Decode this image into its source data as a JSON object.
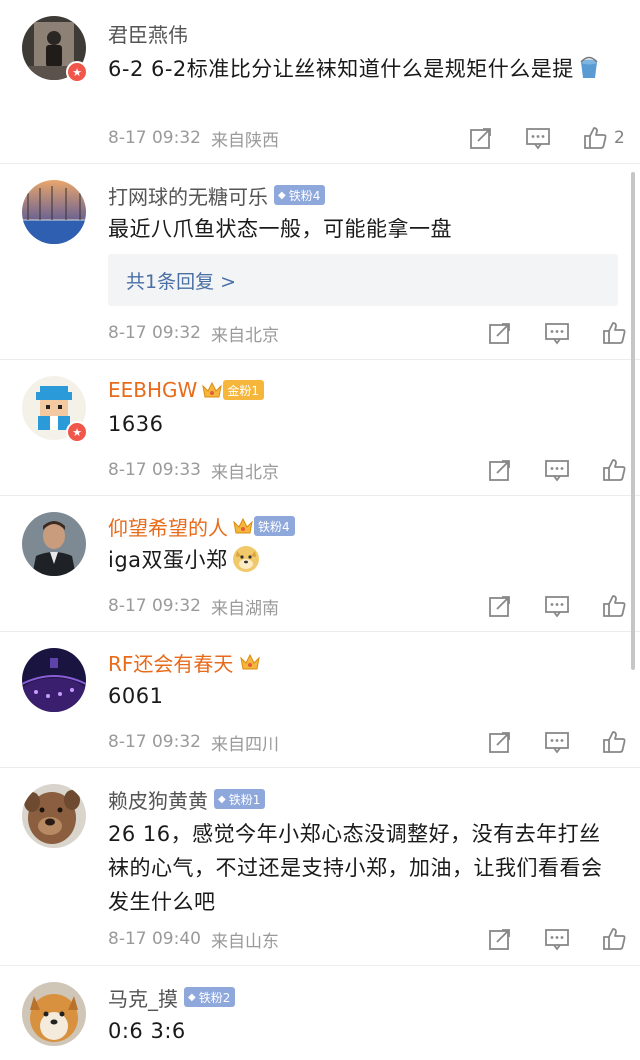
{
  "comments": [
    {
      "username": "君臣燕伟",
      "text": "6-2 6-2标准比分让丝袜知道什么是规矩什么是提",
      "emoji": "bucket-emoji",
      "time": "8-17 09:32",
      "location": "来自陕西",
      "likes": "2",
      "verified": true
    },
    {
      "username": "打网球的无糖可乐",
      "badge": "铁粉4",
      "text": "最近八爪鱼状态一般，可能能拿一盘",
      "reply": "共1条回复 >",
      "time": "8-17 09:32",
      "location": "来自北京"
    },
    {
      "username": "EEBHGW",
      "badge": "金粉1",
      "text": "1636",
      "time": "8-17 09:33",
      "location": "来自北京",
      "verified": true
    },
    {
      "username": "仰望希望的人",
      "badge": "铁粉4",
      "text": "iga双蛋小郑",
      "emoji": "doge-emoji",
      "time": "8-17 09:32",
      "location": "来自湖南"
    },
    {
      "username": "RF还会有春天",
      "text": "6061",
      "time": "8-17 09:32",
      "location": "来自四川"
    },
    {
      "username": "赖皮狗黄黄",
      "badge": "铁粉1",
      "text": "26 16，感觉今年小郑心态没调整好，没有去年打丝袜的心气，不过还是支持小郑，加油，让我们看看会发生什么吧",
      "time": "8-17 09:40",
      "location": "来自山东"
    },
    {
      "username": "马克_摸",
      "badge": "铁粉2",
      "text": "0:6 3:6"
    }
  ],
  "icons": {
    "share": "share-icon",
    "comment": "comment-icon",
    "like": "thumbs-up-icon",
    "verified": "verified-star-icon",
    "crown": "crown-icon"
  },
  "colors": {
    "vip_name": "#e86b1b",
    "iron_badge": "#8fa8dc",
    "gold_badge": "#f5b63b",
    "reply_link": "#4a6fa5",
    "verified_badge": "#f0574a"
  }
}
